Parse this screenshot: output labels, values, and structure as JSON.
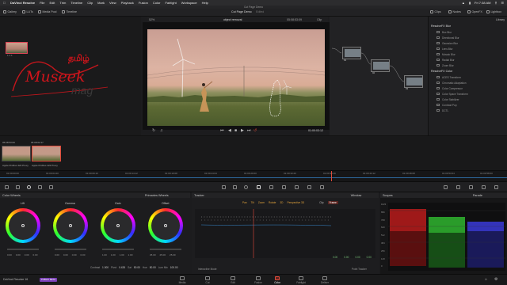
{
  "menubar": {
    "app": "DaVinci Resolve",
    "items": [
      "File",
      "Edit",
      "Trim",
      "Timeline",
      "Clip",
      "Mark",
      "View",
      "Playback",
      "Fusion",
      "Color",
      "Fairlight",
      "Workspace",
      "Help"
    ],
    "time": "Fri 7:38 AM"
  },
  "window_title": "Cut Page Demo",
  "toolbar": {
    "left": [
      "Gallery",
      "LUTs",
      "Media Pool",
      "Timeline"
    ],
    "project": "Cut Page Demo",
    "project_status": "Edited",
    "right": [
      "Clips",
      "Nodes",
      "OpenFX",
      "Lightbox"
    ]
  },
  "viewer": {
    "zoom": "52%",
    "clip_name": "object removal",
    "timecode_top": "05:08:53:09",
    "timecode_bottom": "01:00:03:12",
    "clip_label": "Clip"
  },
  "gallery": {
    "still_label": "1.1.1"
  },
  "logo": {
    "tamil": "தமிழ்",
    "script": "Museek",
    "mag": "mag"
  },
  "nodes": [
    {
      "label": "01"
    },
    {
      "label": "02"
    },
    {
      "label": "03"
    }
  ],
  "effects": {
    "tab": "Library",
    "section1": "ResolveFX Blur",
    "items1": [
      "Box Blur",
      "Directional Blur",
      "Gaussian Blur",
      "Lens Blur",
      "Mosaic Blur",
      "Radial Blur",
      "Zoom Blur"
    ],
    "section2": "ResolveFX Color",
    "items2": [
      "ACES Transform",
      "Chromatic Adaptation",
      "Color Compressor",
      "Color Space Transform",
      "Color Stabilizer",
      "Contrast Pop",
      "DCTL"
    ]
  },
  "clips": [
    {
      "timecode": "05:08:53:09",
      "index": "01",
      "codec": "Apple ProRes 422 Proxy"
    },
    {
      "timecode": "05:08:02:17",
      "index": "02",
      "codec": "Apple ProRes 422 Proxy"
    }
  ],
  "ruler": [
    "01:00:00:00",
    "01:00:04:20",
    "01:00:09:16",
    "01:00:14:12",
    "01:00:19:08",
    "01:00:24:04",
    "01:00:29:00",
    "01:00:33:20",
    "01:00:38:16",
    "01:00:43:12",
    "01:00:48:08",
    "01:00:53:04",
    "01:00:58:00"
  ],
  "panels": {
    "color_wheels": "Color Wheels",
    "primaries": "Primaries Wheels",
    "tracker": "Tracker",
    "window": "Window",
    "scopes": "Scopes",
    "parade": "Parade"
  },
  "wheels": [
    {
      "name": "Lift",
      "values": [
        "0.00",
        "0.00",
        "0.00",
        "0.00"
      ]
    },
    {
      "name": "Gamma",
      "values": [
        "0.00",
        "0.00",
        "0.00",
        "0.00"
      ]
    },
    {
      "name": "Gain",
      "values": [
        "1.00",
        "1.00",
        "1.00",
        "1.00"
      ]
    },
    {
      "name": "Offset",
      "values": [
        "25.00",
        "25.00",
        "25.00"
      ]
    }
  ],
  "adjust": {
    "contrast_label": "Contrast",
    "contrast": "1.000",
    "pivot_label": "Pivot",
    "pivot": "0.435",
    "sat_label": "Sat",
    "sat": "50.00",
    "hue_label": "Hue",
    "hue": "50.00",
    "lum_label": "Lum Mix",
    "lum": "100.00"
  },
  "tracker": {
    "checks": [
      "Pan",
      "Tilt",
      "Zoom",
      "Rotate",
      "3D",
      "Perspective 3D"
    ],
    "clip": "Clip",
    "frame": "Frame",
    "mode": "Interactive Mode",
    "point": "Point Tracker",
    "values": [
      "0.00",
      "0.00",
      "0.00",
      "0.00"
    ]
  },
  "scopes": {
    "scale": [
      "1023",
      "896",
      "768",
      "640",
      "512",
      "384",
      "256",
      "128",
      "0"
    ]
  },
  "footer": {
    "app_label": "DaVinci Resolve 16",
    "badge": "PUBLIC BETA",
    "pages": [
      "Media",
      "Cut",
      "Edit",
      "Fusion",
      "Color",
      "Fairlight",
      "Deliver"
    ],
    "active_page": "Color"
  },
  "colors": {
    "accent": "#e14b3b",
    "background": "#1c1c1e"
  }
}
